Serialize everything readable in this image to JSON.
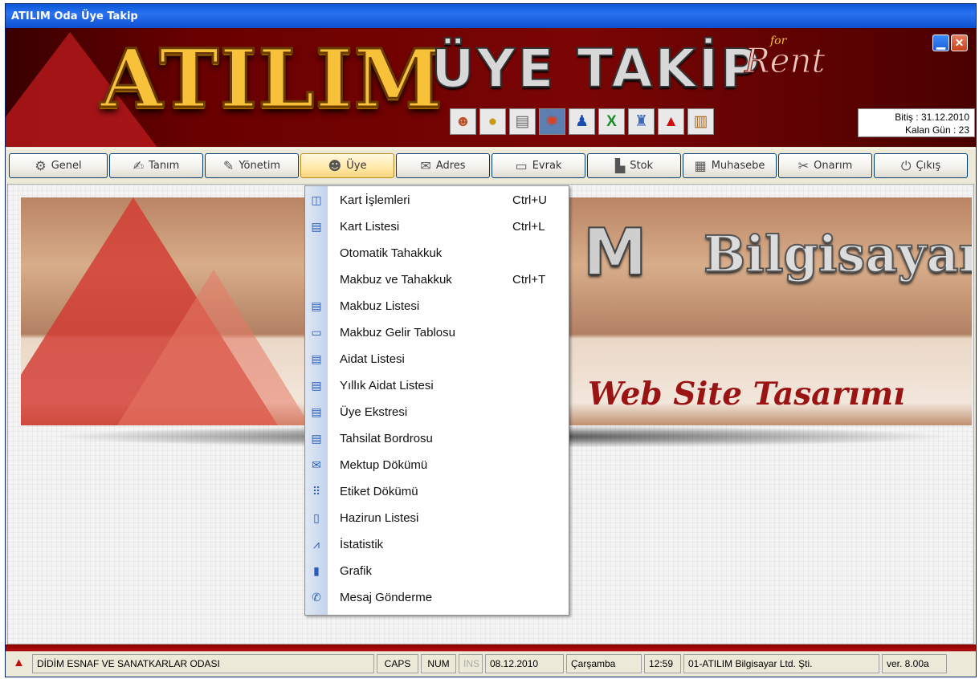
{
  "window": {
    "title": "ATILIM Oda Üye Takip"
  },
  "banner": {
    "logo_text": "ATILIM",
    "app_title": "ÜYE TAKİP",
    "for_tag": "for",
    "rent_tag": "Rent",
    "minimize": "▁",
    "close": "✕",
    "info": {
      "bitis": "Bitiş : 31.12.2010",
      "kalan": "Kalan Gün : 23"
    },
    "toolbar_icons": [
      "users-icon",
      "coins-icon",
      "printer-icon",
      "settings-icon",
      "user-icon",
      "excel-icon",
      "workers-icon",
      "atilim-logo-icon",
      "book-icon"
    ]
  },
  "menu": [
    {
      "label": "Genel",
      "icon": "gear-icon",
      "glyph": "⚙"
    },
    {
      "label": "Tanım",
      "icon": "handshake-icon",
      "glyph": "✍"
    },
    {
      "label": "Yönetim",
      "icon": "drafting-icon",
      "glyph": "✎"
    },
    {
      "label": "Üye",
      "icon": "members-icon",
      "glyph": "☻"
    },
    {
      "label": "Adres",
      "icon": "envelope-icon",
      "glyph": "✉"
    },
    {
      "label": "Evrak",
      "icon": "document-icon",
      "glyph": "▭"
    },
    {
      "label": "Stok",
      "icon": "factory-icon",
      "glyph": "▙"
    },
    {
      "label": "Muhasebe",
      "icon": "calculator-icon",
      "glyph": "▦"
    },
    {
      "label": "Onarım",
      "icon": "tools-icon",
      "glyph": "✂"
    },
    {
      "label": "Çıkış",
      "icon": "power-icon",
      "glyph": "⏻"
    }
  ],
  "dropdown": [
    {
      "label": "Kart İşlemleri",
      "shortcut": "Ctrl+U",
      "icon": "card-icon",
      "glyph": "◫"
    },
    {
      "label": "Kart Listesi",
      "shortcut": "Ctrl+L",
      "icon": "list-report-icon",
      "glyph": "▤"
    },
    {
      "label": "Otomatik Tahakkuk",
      "shortcut": "",
      "icon": "",
      "glyph": ""
    },
    {
      "label": "Makbuz ve Tahakkuk",
      "shortcut": "Ctrl+T",
      "icon": "",
      "glyph": ""
    },
    {
      "label": "Makbuz Listesi",
      "shortcut": "",
      "icon": "list-report-icon",
      "glyph": "▤"
    },
    {
      "label": "Makbuz Gelir Tablosu",
      "shortcut": "",
      "icon": "table-icon",
      "glyph": "▭"
    },
    {
      "label": "Aidat Listesi",
      "shortcut": "",
      "icon": "list-report-icon",
      "glyph": "▤"
    },
    {
      "label": "Yıllık Aidat Listesi",
      "shortcut": "",
      "icon": "list-report-icon",
      "glyph": "▤"
    },
    {
      "label": "Üye Ekstresi",
      "shortcut": "",
      "icon": "list-report-icon",
      "glyph": "▤"
    },
    {
      "label": "Tahsilat Bordrosu",
      "shortcut": "",
      "icon": "list-report-icon",
      "glyph": "▤"
    },
    {
      "label": "Mektup Dökümü",
      "shortcut": "",
      "icon": "envelope-icon",
      "glyph": "✉"
    },
    {
      "label": "Etiket Dökümü",
      "shortcut": "",
      "icon": "label-grid-icon",
      "glyph": "⠿"
    },
    {
      "label": "Hazirun Listesi",
      "shortcut": "",
      "icon": "clipboard-icon",
      "glyph": "▯"
    },
    {
      "label": "İstatistik",
      "shortcut": "",
      "icon": "chart-line-icon",
      "glyph": "⩘"
    },
    {
      "label": "Grafik",
      "shortcut": "",
      "icon": "bar-chart-icon",
      "glyph": "▮"
    },
    {
      "label": "Mesaj Gönderme",
      "shortcut": "",
      "icon": "satellite-icon",
      "glyph": "✆"
    }
  ],
  "wallpaper": {
    "brand": "Bilgisayar",
    "brand_prefix": "M",
    "tagline": "Web Site Tasarımı"
  },
  "status": {
    "org": "DİDİM ESNAF VE SANATKARLAR ODASI",
    "caps": "CAPS",
    "num": "NUM",
    "ins": "INS",
    "date": "08.12.2010",
    "day": "Çarşamba",
    "time": "12:59",
    "company": "01-ATILIM Bilgisayar Ltd. Şti.",
    "version": "ver. 8.00a"
  }
}
